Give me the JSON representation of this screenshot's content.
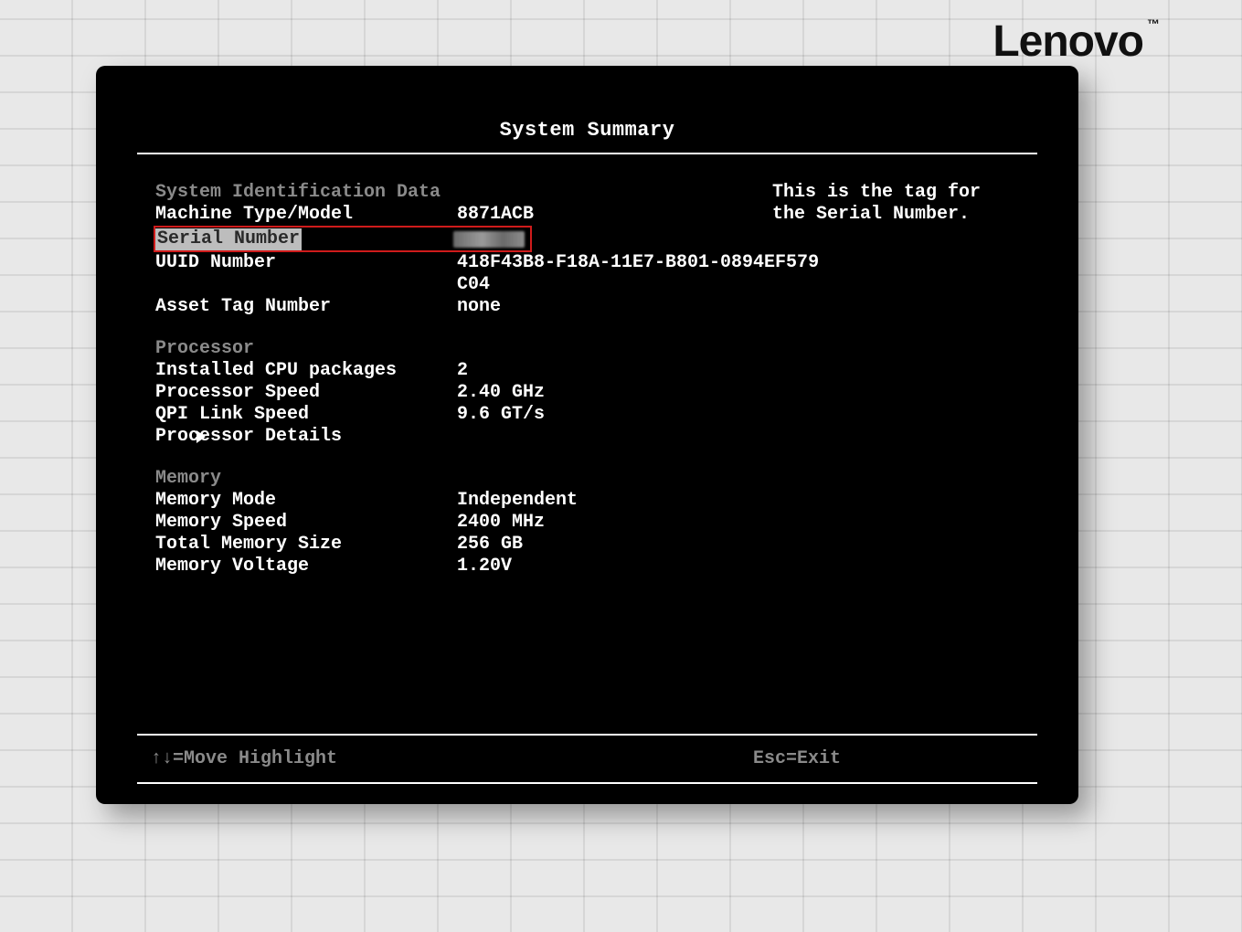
{
  "brand": "Lenovo",
  "title": "System Summary",
  "help_text": "This is the tag for the Serial Number.",
  "sections": {
    "sysid": {
      "header": "System Identification Data",
      "machine_type_label": "Machine Type/Model",
      "machine_type_value": "8871ACB",
      "serial_label": "Serial Number",
      "serial_value": "",
      "uuid_label": "UUID Number",
      "uuid_value_line1": "418F43B8-F18A-11E7-B801-0894EF579",
      "uuid_value_line2": "C04",
      "asset_tag_label": "Asset Tag Number",
      "asset_tag_value": "none"
    },
    "processor": {
      "header": "Processor",
      "installed_label": "Installed CPU packages",
      "installed_value": "2",
      "speed_label": "Processor Speed",
      "speed_value": "2.40 GHz",
      "qpi_label": "QPI Link Speed",
      "qpi_value": "9.6 GT/s",
      "details_label": "Processor Details"
    },
    "memory": {
      "header": "Memory",
      "mode_label": "Memory Mode",
      "mode_value": "Independent",
      "speed_label": "Memory Speed",
      "speed_value": "2400 MHz",
      "size_label": "Total Memory Size",
      "size_value": "256 GB",
      "voltage_label": "Memory Voltage",
      "voltage_value": "1.20V"
    }
  },
  "footer": {
    "move": "↑↓=Move Highlight",
    "exit": "Esc=Exit"
  }
}
